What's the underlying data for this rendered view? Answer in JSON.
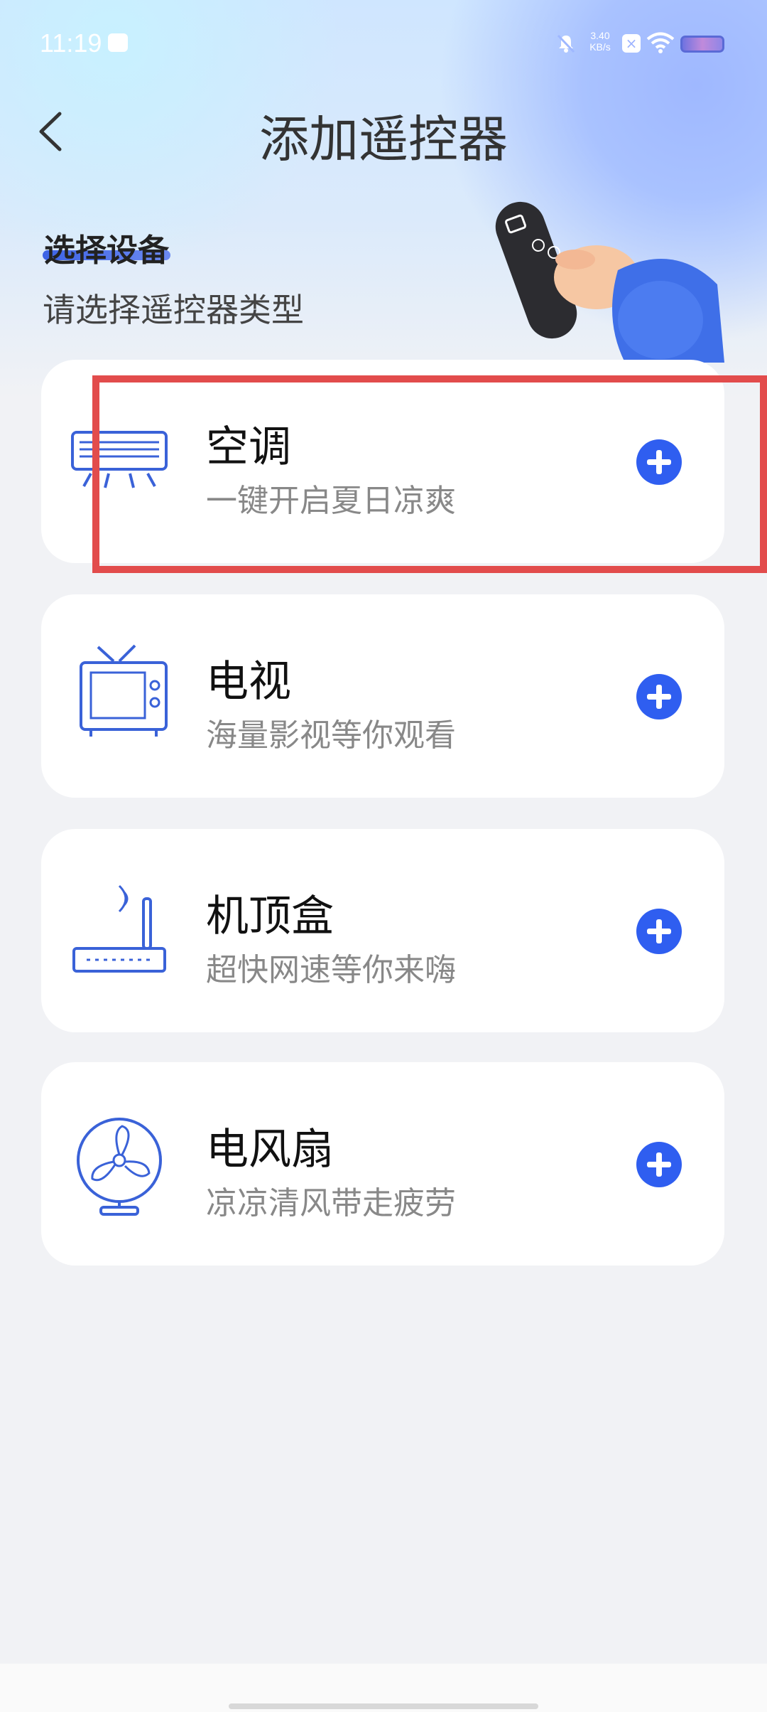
{
  "status_bar": {
    "time": "11:19",
    "net_speed_value": "3.40",
    "net_speed_unit": "KB/s"
  },
  "header": {
    "title": "添加遥控器",
    "back_icon": "chevron-left-icon"
  },
  "section": {
    "title": "选择设备",
    "subtitle": "请选择遥控器类型",
    "accent_color": "#3d63e6"
  },
  "devices": [
    {
      "name": "空调",
      "desc": "一键开启夏日凉爽",
      "icon": "air-conditioner-icon"
    },
    {
      "name": "电视",
      "desc": "海量影视等你观看",
      "icon": "tv-icon"
    },
    {
      "name": "机顶盒",
      "desc": "超快网速等你来嗨",
      "icon": "set-top-box-icon"
    },
    {
      "name": "电风扇",
      "desc": "凉凉清风带走疲劳",
      "icon": "fan-icon"
    }
  ],
  "colors": {
    "primary": "#2f5ef0",
    "icon_stroke": "#3a62d8",
    "highlight": "#e24c4c"
  }
}
